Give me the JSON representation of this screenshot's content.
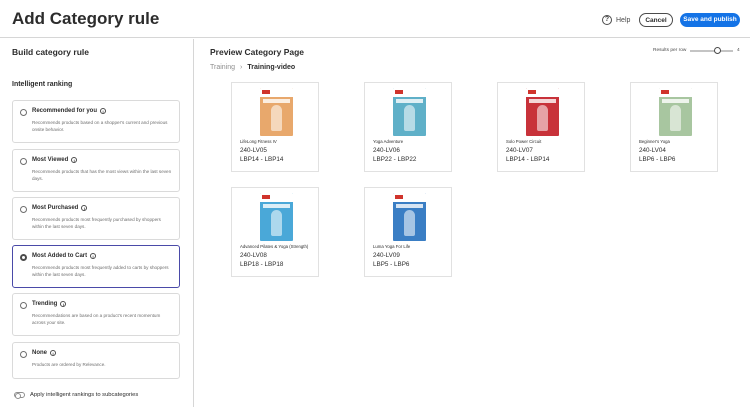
{
  "header": {
    "title": "Add Category rule",
    "help_label": "Help",
    "cancel_label": "Cancel",
    "save_label": "Save and publish",
    "accent_color": "#1473e6"
  },
  "left_panel": {
    "title": "Build category rule",
    "section_title": "Intelligent ranking",
    "options": [
      {
        "label": "Recommended for you",
        "description": "Recommends products based on a shopper's current and previous onsite behavior.",
        "selected": false
      },
      {
        "label": "Most Viewed",
        "description": "Recommends products that has the most views within the last seven days.",
        "selected": false
      },
      {
        "label": "Most Purchased",
        "description": "Recommends products most frequently purchased by shoppers within the last seven days.",
        "selected": false
      },
      {
        "label": "Most Added to Cart",
        "description": "Recommends products most frequently added to carts by shoppers within the last seven days.",
        "selected": true
      },
      {
        "label": "Trending",
        "description": "Recommendations are based on a product's recent momentum across your site.",
        "selected": false
      },
      {
        "label": "None",
        "description": "Products are ordered by Relevance.",
        "selected": false
      }
    ],
    "toggle_label": "Apply intelligent rankings to subcategories",
    "toggle_on": false
  },
  "preview": {
    "title": "Preview Category Page",
    "results_per_row_label": "Results per row",
    "results_per_row_value": "4",
    "breadcrumb": {
      "parent": "Training",
      "current": "Training-video"
    },
    "products": [
      {
        "name": "LifeLong Fitness IV",
        "sku": "240-LV05",
        "code": "LBP14 - LBP14",
        "cover_color": "#e8a86c"
      },
      {
        "name": "Yoga Adventure",
        "sku": "240-LV06",
        "code": "LBP22 - LBP22",
        "cover_color": "#5fb0c8"
      },
      {
        "name": "Solo Power Circuit",
        "sku": "240-LV07",
        "code": "LBP14 - LBP14",
        "cover_color": "#c8323a"
      },
      {
        "name": "Beginner's Yoga",
        "sku": "240-LV04",
        "code": "LBP6 - LBP6",
        "cover_color": "#a8c6a0"
      },
      {
        "name": "Advanced Pilates & Yoga (Strength)",
        "sku": "240-LV08",
        "code": "LBP18 - LBP18",
        "cover_color": "#4aa8d8"
      },
      {
        "name": "Luma Yoga For Life",
        "sku": "240-LV09",
        "code": "LBP5 - LBP6",
        "cover_color": "#3a7ec4"
      }
    ]
  }
}
